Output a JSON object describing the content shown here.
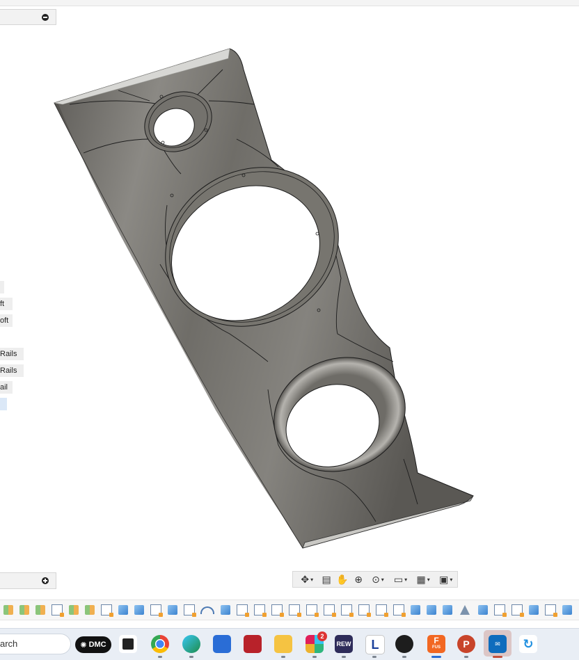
{
  "browser": {
    "collapse_icon": "minus-circle-icon"
  },
  "tree_items": [
    {
      "label": ""
    },
    {
      "label": "ft"
    },
    {
      "label": "oft"
    },
    {
      "label": "Rails"
    },
    {
      "label": "Rails"
    },
    {
      "label": "ail"
    },
    {
      "label": ""
    }
  ],
  "comments": {
    "expand_icon": "plus-circle-icon"
  },
  "navigation_bar": {
    "buttons": [
      "orbit-icon",
      "look-at-icon",
      "pan-icon",
      "zoom-icon",
      "fit-icon",
      "display-settings-icon",
      "grid-settings-icon",
      "viewports-icon"
    ]
  },
  "model": {
    "name": "speaker-baffle",
    "body_color": "#7a7872",
    "edge_color": "#1c1c1c"
  },
  "taskbar": {
    "search_text": "arch",
    "dmc_label": "DMC",
    "rew_label": "REW",
    "slack_badge": "2",
    "fusion_label": "F",
    "fusion_sub": "FUS",
    "powerpoint_label": "P"
  }
}
